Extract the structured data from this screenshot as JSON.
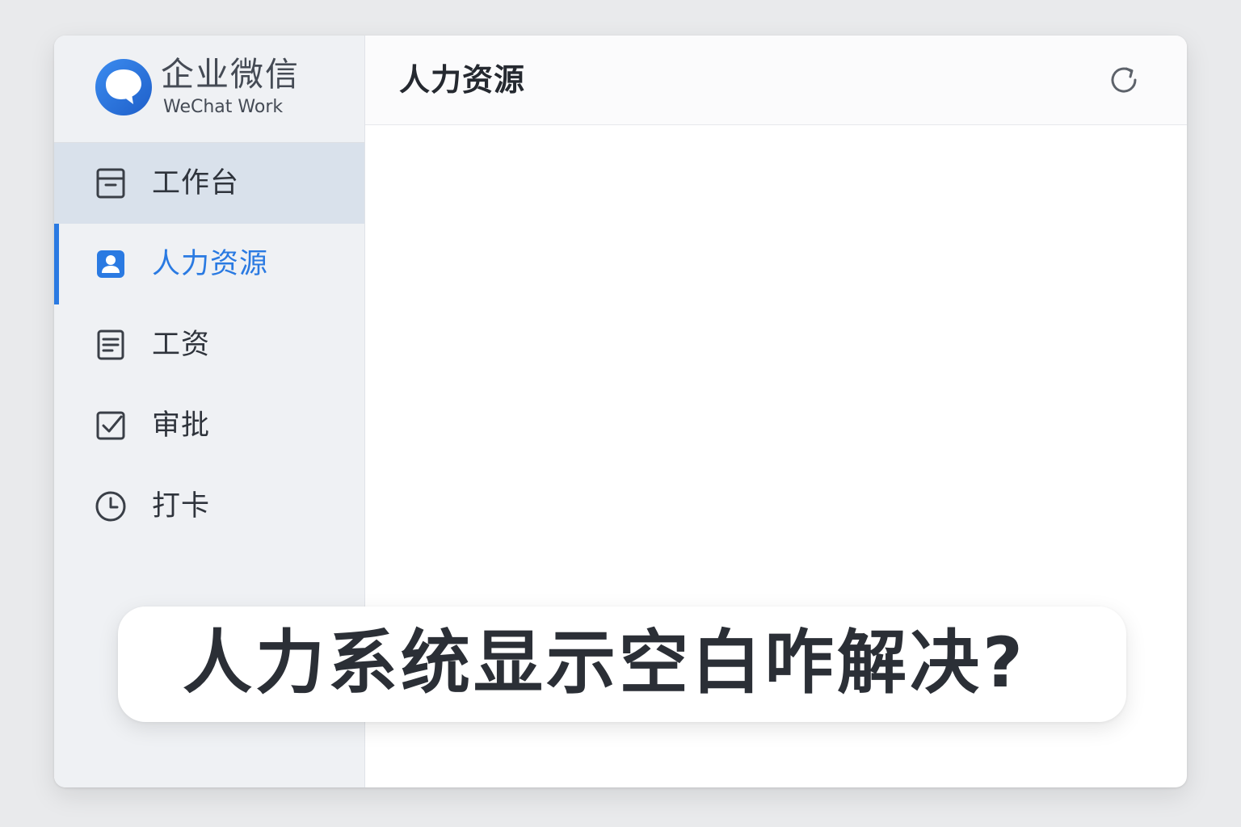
{
  "app": {
    "name_cn": "企业微信",
    "name_en": "WeChat Work",
    "accent_color": "#2a7ae2"
  },
  "sidebar": {
    "items": [
      {
        "label": "工作台",
        "icon": "workbench-icon",
        "state": "hover"
      },
      {
        "label": "人力资源",
        "icon": "user-card-icon",
        "state": "active"
      },
      {
        "label": "工资",
        "icon": "document-icon",
        "state": "normal"
      },
      {
        "label": "审批",
        "icon": "checkbox-icon",
        "state": "normal"
      },
      {
        "label": "打卡",
        "icon": "clock-icon",
        "state": "normal"
      }
    ]
  },
  "main": {
    "title": "人力资源",
    "refresh_icon": "refresh-icon"
  },
  "banner": {
    "text": "人力系统显示空白咋解决?"
  }
}
